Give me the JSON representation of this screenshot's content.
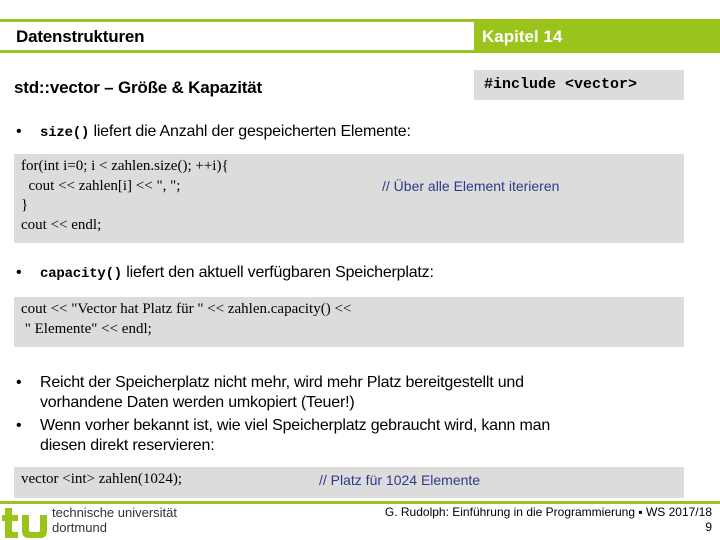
{
  "header": {
    "title": "Datenstrukturen",
    "chapter": "Kapitel 14"
  },
  "slide_title": "std::vector – Größe & Kapazität",
  "include": "#include <vector>",
  "bullets": [
    {
      "code": "size()",
      "text": " liefert die Anzahl der gespeicherten Elemente:"
    },
    {
      "code": "capacity()",
      "text": " liefert den aktuell verfügbaren Speicherplatz:"
    },
    {
      "lines": [
        "Reicht der Speicherplatz nicht mehr, wird mehr Platz bereitgestellt und",
        "vorhandene Daten werden umkopiert (Teuer!)"
      ]
    },
    {
      "lines": [
        "Wenn vorher bekannt ist, wie viel Speicherplatz gebraucht wird, kann man",
        "diesen direkt reservieren:"
      ]
    }
  ],
  "code_blocks": [
    {
      "lines": [
        "for(int i=0; i < zahlen.size(); ++i){",
        "  cout << zahlen[i] << \", \";",
        "}",
        "cout << endl;"
      ],
      "comment": "// Über alle Element iterieren"
    },
    {
      "lines": [
        "cout << \"Vector hat Platz für \" << zahlen.capacity() <<",
        " \" Elemente\" << endl;"
      ]
    },
    {
      "lines": [
        "vector <int> zahlen(1024);"
      ],
      "comment": "// Platz für 1024 Elemente"
    }
  ],
  "bullet_glyph": "•",
  "footer": {
    "university_line1": "technische universität",
    "university_line2": "dortmund",
    "credit": "G. Rudolph: Einführung in die Programmierung ▪ WS 2017/18",
    "page": "9"
  },
  "colors": {
    "accent": "#9ac31c",
    "code_bg": "#dcdcdc",
    "comment": "#2e3a87"
  }
}
